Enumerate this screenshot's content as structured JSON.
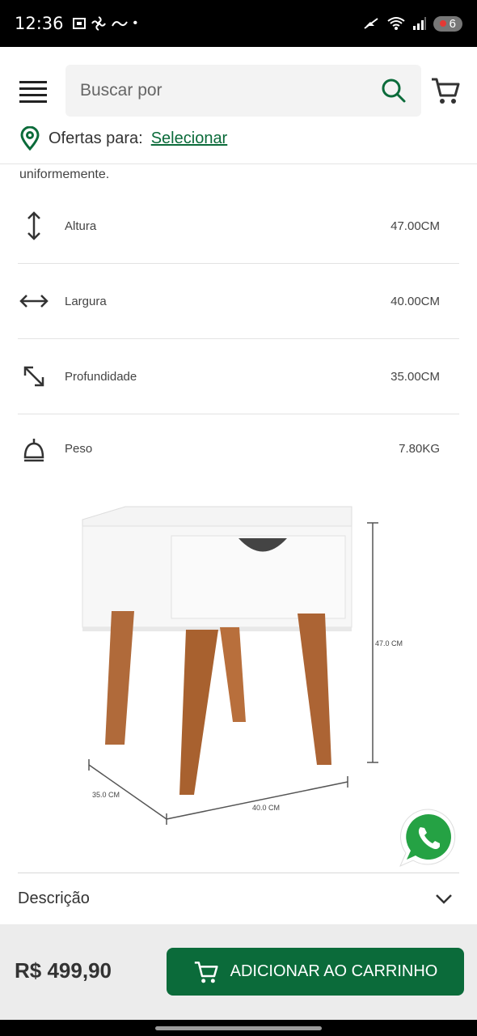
{
  "status_bar": {
    "time": "12:36",
    "battery": "6"
  },
  "header": {
    "search_placeholder": "Buscar por",
    "offers_label": "Ofertas para:",
    "offers_link": "Selecionar"
  },
  "content": {
    "intro_text": "uniformemente.",
    "specs": [
      {
        "label": "Altura",
        "value": "47.00CM",
        "icon": "height-arrow-icon"
      },
      {
        "label": "Largura",
        "value": "40.00CM",
        "icon": "width-arrow-icon"
      },
      {
        "label": "Profundidade",
        "value": "35.00CM",
        "icon": "depth-arrow-icon"
      },
      {
        "label": "Peso",
        "value": "7.80KG",
        "icon": "weight-icon"
      }
    ],
    "figure_labels": {
      "height": "47.0 CM",
      "depth": "35.0 CM",
      "width": "40.0 CM"
    }
  },
  "description": {
    "label": "Descrição"
  },
  "bottom_bar": {
    "price": "R$ 499,90",
    "add_button": "ADICIONAR AO CARRINHO"
  },
  "colors": {
    "brand_green": "#0b6b3a",
    "whatsapp_green": "#25a244"
  }
}
